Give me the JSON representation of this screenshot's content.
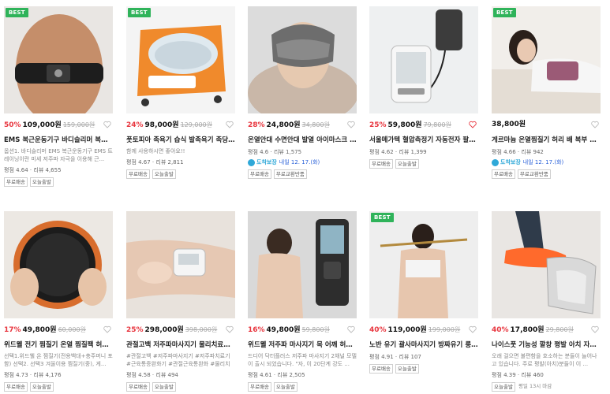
{
  "colors": {
    "discount": "#e8363f",
    "best_badge": "#2fb35a",
    "delivery": "#2fa8d8"
  },
  "products": [
    {
      "best": "BEST",
      "rate": "50%",
      "price": "109,000원",
      "orig": "159,000원",
      "title": "EMS 복근운동기구 바디슬리머 복부다...",
      "desc": "옵션1. 바디슬리머 EMS 복근운동기구 EMS 트레이닝이란 미세 저주파 자극을 이용해 근...",
      "rating": "평점 4.64",
      "reviews": "리뷰 4,655",
      "tags": [
        "무료배송",
        "오늘출발"
      ]
    },
    {
      "best": "BEST",
      "rate": "24%",
      "price": "98,000원",
      "orig": "129,000원",
      "title": "풋토피아 족욕기 습식 발족욕기 족당기...",
      "desc": "함께 사용하시면 좋아요!!",
      "rating": "평점 4.67",
      "reviews": "리뷰 2,811",
      "tags": [
        "무료배송",
        "오늘출발"
      ]
    },
    {
      "best": "",
      "rate": "28%",
      "price": "24,800원",
      "orig": "34,800원",
      "title": "온열안대 수면안대 발열 아이마스크 눈...",
      "desc": "",
      "rating": "평점 4.6",
      "reviews": "리뷰 1,575",
      "delivery_label": "도착보장",
      "delivery_date": "내일 12. 17.(화)",
      "tags": [
        "무료배송",
        "무료교환반품"
      ]
    },
    {
      "best": "",
      "rate": "25%",
      "price": "59,800원",
      "orig": "79,800원",
      "title": "서울메가텍 혈압측정기 자동전자 팔뚝형...",
      "desc": "",
      "rating": "평점 4.62",
      "reviews": "리뷰 1,399",
      "tags": [
        "무료배송",
        "오늘출발"
      ]
    },
    {
      "best": "BEST",
      "rate": "",
      "price": "38,800원",
      "orig": "",
      "title": "게르마늄 온열찜질기 허리 배 복부 무릎 ...",
      "desc": "",
      "rating": "평점 4.66",
      "reviews": "리뷰 942",
      "delivery_label": "도착보장",
      "delivery_date": "내일 12. 17.(화)",
      "tags": [
        "무료배송",
        "무료교환반품"
      ]
    },
    {
      "best": "",
      "rate": "17%",
      "price": "49,800원",
      "orig": "60,000원",
      "title": "위드웰 전기 찜질기 온열 찜질팩 허리 복...",
      "desc": "선택1.위드웰 온 찜질기(전용백대+충주머니 포함) 선택2. 선택3 겨울이용 찜질기(중), 게...",
      "rating": "평점 4.73",
      "reviews": "리뷰 4,176",
      "tags": [
        "무료배송",
        "오늘출발"
      ]
    },
    {
      "best": "",
      "rate": "25%",
      "price": "298,000원",
      "orig": "398,000원",
      "title": "관절고백 저주파마사지기 물리치료기x ...",
      "desc": "#관절고백 #저주파마사지기 #저주파치료기 #근육통증완화기 #관절근육통완화 #물리치료...",
      "rating": "평점 4.58",
      "reviews": "리뷰 494",
      "tags": [
        "무료배송",
        "오늘출발"
      ]
    },
    {
      "best": "",
      "rate": "16%",
      "price": "49,800원",
      "orig": "59,800원",
      "title": "위드웰 저주파 마사지기 목 어깨 허리 무...",
      "desc": "드디어 닥터플러스 저주파 마사지기 2채널 모델이 출시 되었습니다. \"자, 이 20단계 강도 ...",
      "rating": "평점 4.61",
      "reviews": "리뷰 2,505",
      "tags": [
        "무료배송",
        "오늘출발"
      ]
    },
    {
      "best": "BEST",
      "rate": "40%",
      "price": "119,000원",
      "orig": "199,000원",
      "title": "노반 유기 괄사마사지기 방짜유기 롱 바...",
      "desc": "",
      "rating": "평점 4.91",
      "reviews": "리뷰 107",
      "tags": [
        "무료배송",
        "오늘출발"
      ]
    },
    {
      "best": "",
      "rate": "40%",
      "price": "17,800원",
      "orig": "29,800원",
      "title": "나이스풋 기능성 깔창 평발 아치 자세 교...",
      "desc": "오래 걸으면 불편함을 호소하는 분들이 늘어나고 있습니다. 주로 평발(아치)분들이 이 ...",
      "rating": "평점 4.39",
      "reviews": "리뷰 460",
      "tags": [
        "오늘출발"
      ],
      "tag_note": "평일 13시 마감"
    }
  ]
}
